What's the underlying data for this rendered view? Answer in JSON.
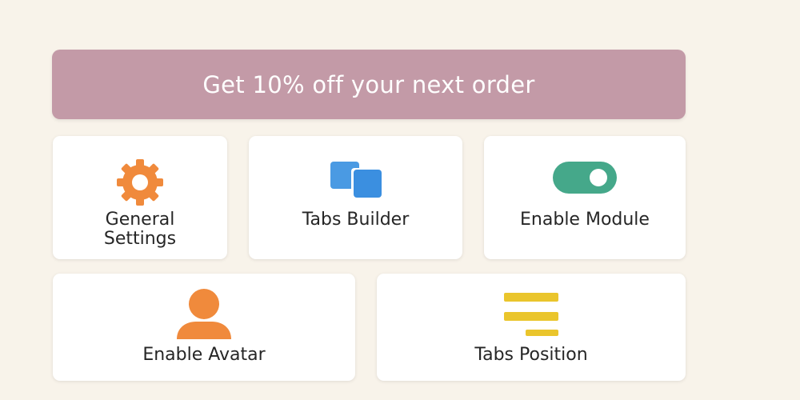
{
  "banner": {
    "text": "Get 10% off your next order",
    "color": "#c39aa7"
  },
  "cards": {
    "general_settings": {
      "label_line1": "General",
      "label_line2": "Settings",
      "icon": "gear-icon",
      "icon_color": "#f08a3c"
    },
    "tabs_builder": {
      "label": "Tabs Builder",
      "icon": "tabs-icon",
      "icon_color": "#3b8fe0"
    },
    "enable_module": {
      "label": "Enable Module",
      "icon": "toggle-icon",
      "icon_color": "#45a88a"
    },
    "enable_avatar": {
      "label": "Enable Avatar",
      "icon": "user-icon",
      "icon_color": "#f08a3c"
    },
    "tabs_position": {
      "label": "Tabs Position",
      "icon": "align-lines-icon",
      "icon_color": "#eac52c"
    }
  }
}
